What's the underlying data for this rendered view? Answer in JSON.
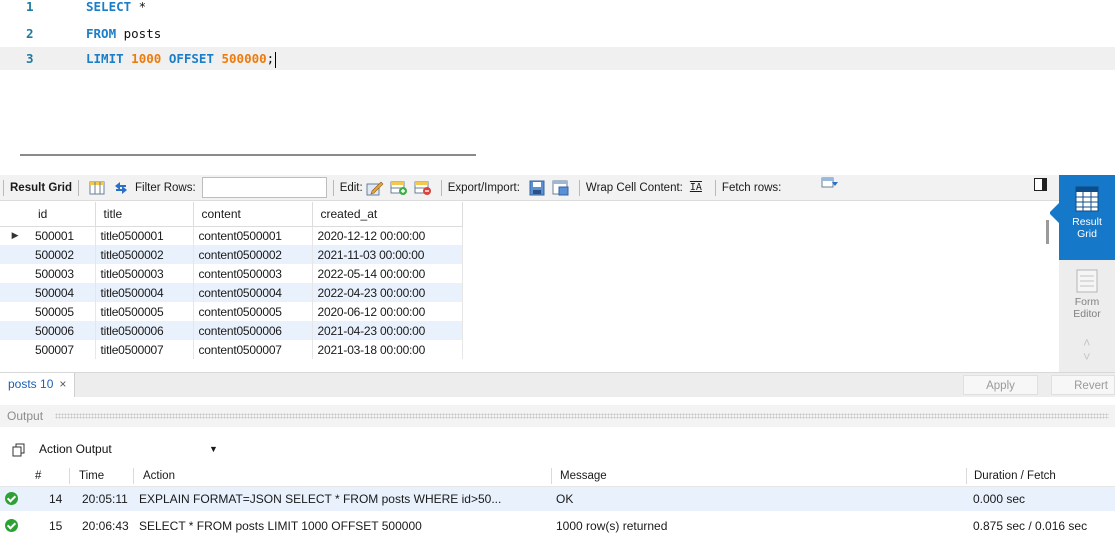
{
  "editor": {
    "lines": [
      {
        "number": "1",
        "kw1": "SELECT",
        "rest": " *"
      },
      {
        "number": "2",
        "kw1": "FROM",
        "rest": " posts"
      },
      {
        "number": "3",
        "kw1": "LIMIT",
        "num1": "1000",
        "kw2": "OFFSET",
        "num2": "500000",
        "end": ";"
      }
    ]
  },
  "toolbar": {
    "result_grid": "Result Grid",
    "filter_rows": "Filter Rows:",
    "filter_value": "",
    "edit": "Edit:",
    "export_import": "Export/Import:",
    "wrap_cell": "Wrap Cell Content:",
    "fetch_rows": "Fetch rows:"
  },
  "side_panel": {
    "result_grid_line1": "Result",
    "result_grid_line2": "Grid",
    "form_editor_line1": "Form",
    "form_editor_line2": "Editor"
  },
  "grid": {
    "columns": [
      "id",
      "title",
      "content",
      "created_at"
    ],
    "rows": [
      [
        "500001",
        "title0500001",
        "content0500001",
        "2020-12-12 00:00:00"
      ],
      [
        "500002",
        "title0500002",
        "content0500002",
        "2021-11-03 00:00:00"
      ],
      [
        "500003",
        "title0500003",
        "content0500003",
        "2022-05-14 00:00:00"
      ],
      [
        "500004",
        "title0500004",
        "content0500004",
        "2022-04-23 00:00:00"
      ],
      [
        "500005",
        "title0500005",
        "content0500005",
        "2020-06-12 00:00:00"
      ],
      [
        "500006",
        "title0500006",
        "content0500006",
        "2021-04-23 00:00:00"
      ],
      [
        "500007",
        "title0500007",
        "content0500007",
        "2021-03-18 00:00:00"
      ]
    ]
  },
  "result_tab": {
    "label": "posts 10",
    "close": "×"
  },
  "buttons": {
    "apply": "Apply",
    "revert": "Revert"
  },
  "output": {
    "title": "Output",
    "selector": "Action Output",
    "columns": {
      "num": "#",
      "time": "Time",
      "action": "Action",
      "message": "Message",
      "duration": "Duration / Fetch"
    },
    "rows": [
      {
        "num": "14",
        "time": "20:05:11",
        "action": "EXPLAIN FORMAT=JSON SELECT * FROM posts WHERE id>50...",
        "message": "OK",
        "duration": "0.000 sec"
      },
      {
        "num": "15",
        "time": "20:06:43",
        "action": "SELECT *  FROM posts  LIMIT 1000 OFFSET 500000",
        "message": "1000 row(s) returned",
        "duration": "0.875 sec / 0.016 sec"
      }
    ]
  },
  "colors": {
    "keyword": "#1a7ec8",
    "number": "#ee7b0c",
    "accent": "#1678c8",
    "success": "#2da134",
    "row_alt": "#e8f1fc"
  }
}
